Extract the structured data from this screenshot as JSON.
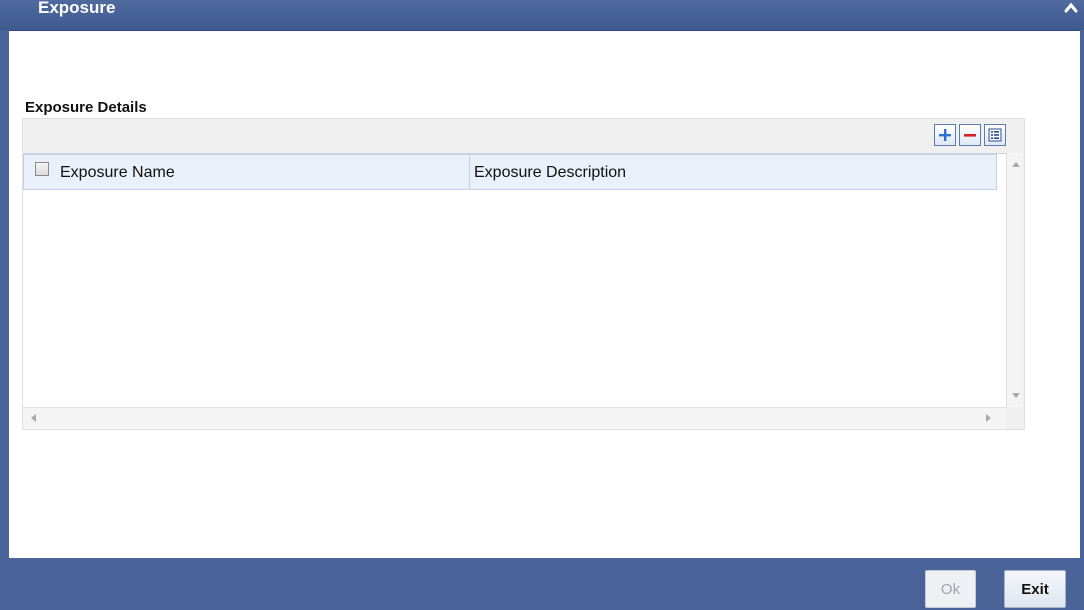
{
  "window": {
    "title": "Exposure"
  },
  "section": {
    "title": "Exposure Details"
  },
  "grid": {
    "columns": [
      "Exposure Name",
      "Exposure Description"
    ],
    "rows": []
  },
  "toolbar": {
    "icons": [
      "add-row-icon",
      "delete-row-icon",
      "single-view-icon"
    ]
  },
  "footer": {
    "ok_label": "Ok",
    "exit_label": "Exit"
  },
  "colors": {
    "frame": "#4a649a",
    "titlebar": "#46619a",
    "header_bg": "#eaf0f9",
    "add_icon": "#2f6fd0",
    "delete_icon": "#d62020"
  }
}
